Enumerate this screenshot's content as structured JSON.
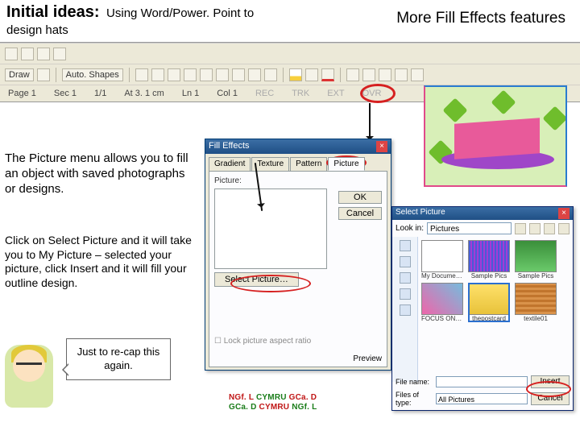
{
  "header": {
    "title_main": "Initial ideas:",
    "title_sub": "Using Word/Power. Point to",
    "title_line2": "design hats",
    "title_right": "More Fill Effects features"
  },
  "toolbar": {
    "draw_label": "Draw",
    "autoshapes_label": "Auto. Shapes"
  },
  "statusbar": {
    "page": "Page 1",
    "sec": "Sec 1",
    "pages": "1/1",
    "at": "At 3. 1 cm",
    "ln": "Ln 1",
    "col": "Col 1",
    "rec": "REC",
    "trk": "TRK",
    "ext": "EXT",
    "ovr": "OVR"
  },
  "para1": "The Picture menu allows you to fill an object with saved photographs or designs.",
  "para2": "Click on Select Picture and it will take you to My Picture – selected your picture, click Insert and it will fill your outline design.",
  "callout": "Just to re-cap this again.",
  "dlg1": {
    "title": "Fill Effects",
    "tabs": {
      "gradient": "Gradient",
      "texture": "Texture",
      "pattern": "Pattern",
      "picture": "Picture"
    },
    "picture_label": "Picture:",
    "select_picture": "Select Picture…",
    "lock_aspect": "Lock picture aspect ratio",
    "ok": "OK",
    "cancel": "Cancel",
    "preview_label": "Preview"
  },
  "dlg2": {
    "title": "Select Picture",
    "lookin_label": "Look in:",
    "lookin_value": "Pictures",
    "thumbs": [
      {
        "cap": "My Documents"
      },
      {
        "cap": "Sample Pics"
      },
      {
        "cap": "Sample Pics"
      },
      {
        "cap": "FOCUS ON DT ART IMAGE"
      },
      {
        "cap": "thepostcard"
      },
      {
        "cap": "textile01"
      }
    ],
    "filename_label": "File name:",
    "filetype_label": "Files of type:",
    "filetype_value": "All Pictures",
    "insert": "Insert",
    "cancel": "Cancel"
  },
  "logo": {
    "line1a": "NGf. L",
    "line1b": "CYMRU",
    "line1c": "GCa. D",
    "line2a": "GCa. D",
    "line2b": "CYMRU",
    "line2c": "NGf. L"
  }
}
